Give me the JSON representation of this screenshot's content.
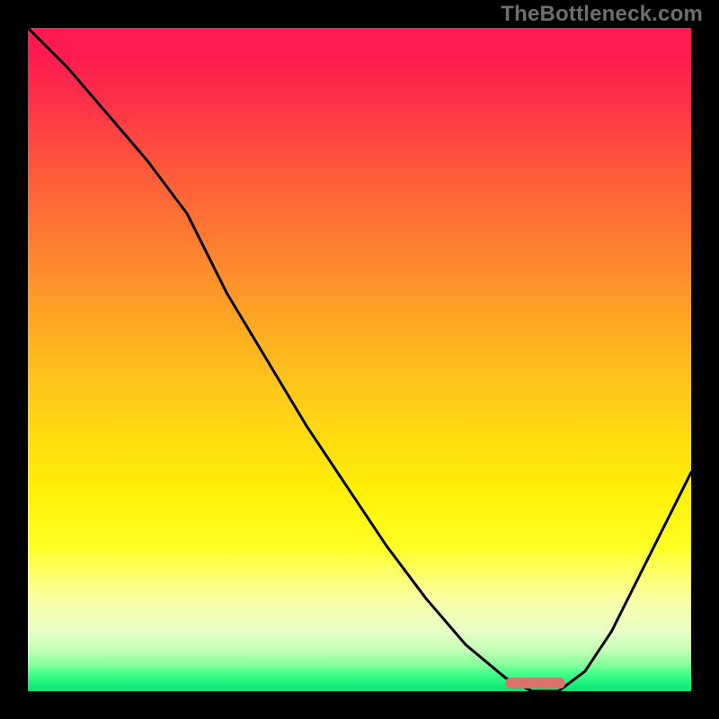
{
  "attribution": "TheBottleneck.com",
  "chart_data": {
    "type": "line",
    "title": "",
    "xlabel": "",
    "ylabel": "",
    "xlim": [
      0,
      100
    ],
    "ylim": [
      0,
      100
    ],
    "grid": false,
    "legend": false,
    "series": [
      {
        "name": "curve",
        "x": [
          0,
          6,
          12,
          18,
          24,
          30,
          36,
          42,
          48,
          54,
          60,
          66,
          72,
          76,
          80,
          84,
          88,
          92,
          96,
          100
        ],
        "y": [
          100,
          94,
          87,
          80,
          72,
          60,
          50,
          40,
          31,
          22,
          14,
          7,
          2,
          0,
          0,
          3,
          9,
          17,
          25,
          33
        ]
      }
    ],
    "marker": {
      "name": "minimum-marker",
      "x_start": 72,
      "x_end": 81,
      "y": 1.2,
      "color": "#d9726a"
    },
    "background_gradient": {
      "stops": [
        {
          "pos": 0.0,
          "color": "#ff1a4f"
        },
        {
          "pos": 0.04,
          "color": "#ff1a4f"
        },
        {
          "pos": 0.1,
          "color": "#ff2d4a"
        },
        {
          "pos": 0.22,
          "color": "#ff5a3a"
        },
        {
          "pos": 0.36,
          "color": "#ff8a2e"
        },
        {
          "pos": 0.48,
          "color": "#ffb41f"
        },
        {
          "pos": 0.6,
          "color": "#ffd713"
        },
        {
          "pos": 0.7,
          "color": "#fff007"
        },
        {
          "pos": 0.78,
          "color": "#ffff22"
        },
        {
          "pos": 0.86,
          "color": "#fbffa3"
        },
        {
          "pos": 0.91,
          "color": "#e8ffc7"
        },
        {
          "pos": 0.94,
          "color": "#bfffb4"
        },
        {
          "pos": 0.96,
          "color": "#85ff9c"
        },
        {
          "pos": 0.975,
          "color": "#3eff89"
        },
        {
          "pos": 1.0,
          "color": "#00e676"
        }
      ]
    }
  }
}
